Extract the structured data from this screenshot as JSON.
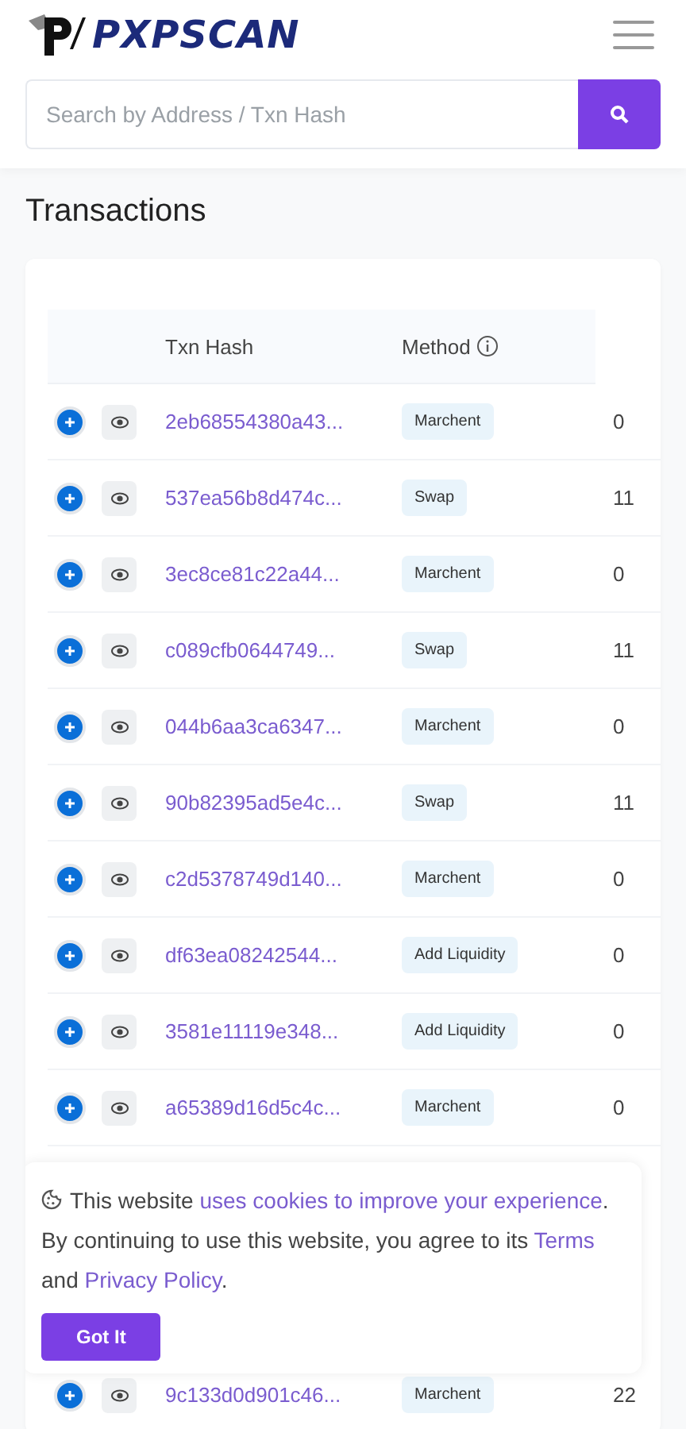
{
  "header": {
    "logo_text": "PXPSCAN",
    "search": {
      "placeholder": "Search by Address / Txn Hash"
    }
  },
  "page_title": "Transactions",
  "table": {
    "columns": [
      "Txn Hash",
      "Method"
    ],
    "rows": [
      {
        "hash": "2eb68554380a43...",
        "method": "Marchent",
        "column_4": "0"
      },
      {
        "hash": "537ea56b8d474c...",
        "method": "Swap",
        "column_4": "11"
      },
      {
        "hash": "3ec8ce81c22a44...",
        "method": "Marchent",
        "column_4": "0"
      },
      {
        "hash": "c089cfb0644749...",
        "method": "Swap",
        "column_4": "11"
      },
      {
        "hash": "044b6aa3ca6347...",
        "method": "Marchent",
        "column_4": "0"
      },
      {
        "hash": "90b82395ad5e4c...",
        "method": "Swap",
        "column_4": "11"
      },
      {
        "hash": "c2d5378749d140...",
        "method": "Marchent",
        "column_4": "0"
      },
      {
        "hash": "df63ea08242544...",
        "method": "Add Liquidity",
        "column_4": "0"
      },
      {
        "hash": "3581e11119e348...",
        "method": "Add Liquidity",
        "column_4": "0"
      },
      {
        "hash": "a65389d16d5c4c...",
        "method": "Marchent",
        "column_4": "0"
      }
    ],
    "rows_after_banner": [
      {
        "hash": "9c133d0d901c46...",
        "method": "Marchent",
        "column_4": "22"
      }
    ]
  },
  "cookie_banner": {
    "parts": [
      {
        "kind": "text",
        "text": "This website "
      },
      {
        "kind": "link",
        "text": "uses cookies to improve your experience"
      },
      {
        "kind": "text",
        "text": ". By continuing to use this website, you agree to its "
      },
      {
        "kind": "link",
        "text": "Terms"
      },
      {
        "kind": "text",
        "text": " and "
      },
      {
        "kind": "link",
        "text": "Privacy Policy"
      },
      {
        "kind": "text",
        "text": "."
      }
    ],
    "button": "Got It"
  }
}
